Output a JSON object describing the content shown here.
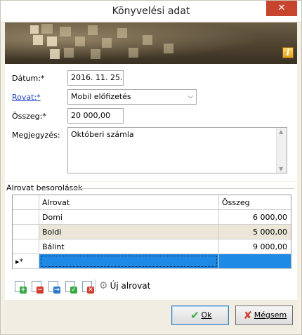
{
  "window": {
    "title": "Könyvelési adat",
    "close_glyph": "✕"
  },
  "banner": {
    "info_icon": "info-icon"
  },
  "form": {
    "date_label": "Dátum:*",
    "date_value": "2016. 11. 25.",
    "category_label": "Rovat:*",
    "category_value": "Mobil előfizetés",
    "amount_label": "Összeg:*",
    "amount_value": "20 000,00",
    "note_label": "Megjegyzés:",
    "note_value": "Októberi számla"
  },
  "subcategories": {
    "title": "Alrovat besorolások",
    "columns": [
      "Alrovat",
      "Összeg"
    ],
    "rows": [
      {
        "name": "Domi",
        "amount": "6 000,00"
      },
      {
        "name": "Boldi",
        "amount": "5 000,00"
      },
      {
        "name": "Bálint",
        "amount": "9 000,00"
      }
    ],
    "new_row_marker": "▸*"
  },
  "toolbar": {
    "new_label": "Új alrovat",
    "icons": [
      "add-row-icon",
      "delete-row-icon",
      "move-row-icon",
      "confirm-row-icon",
      "cancel-row-icon",
      "gear-icon"
    ]
  },
  "buttons": {
    "ok_label": "Ok",
    "cancel_label": "Mégsem"
  },
  "colors": {
    "selection": "#1f8ae6",
    "alt_row": "#ece6d8",
    "link": "#1a3fc4",
    "close_button": "#c7452f"
  }
}
